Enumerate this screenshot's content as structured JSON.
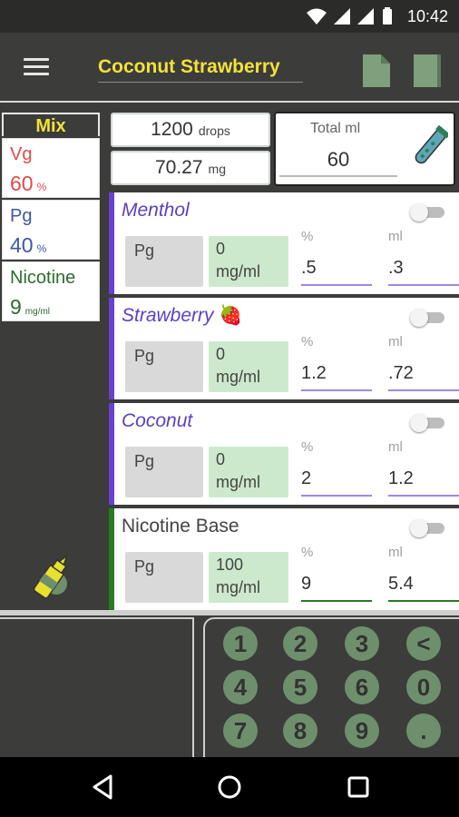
{
  "status_bar": {
    "time": "10:42"
  },
  "app_bar": {
    "title": "Coconut Strawberry"
  },
  "mix": {
    "header": "Mix",
    "vg": {
      "label": "Vg",
      "value": "60",
      "unit": "%"
    },
    "pg": {
      "label": "Pg",
      "value": "40",
      "unit": "%"
    },
    "nicotine": {
      "label": "Nicotine",
      "value": "9",
      "unit": "mg/ml"
    }
  },
  "summary": {
    "drops_value": "1200",
    "drops_unit": "drops",
    "mg_value": "70.27",
    "mg_unit": "mg",
    "total_label": "Total ml",
    "total_value": "60"
  },
  "ingredients": [
    {
      "name": "Menthol",
      "base": "Pg",
      "strength": "0",
      "strength_unit": "mg/ml",
      "percent_label": "%",
      "ml_label": "ml",
      "percent": ".5",
      "ml": ".3"
    },
    {
      "name": "Strawberry",
      "emoji": "🍓",
      "base": "Pg",
      "strength": "0",
      "strength_unit": "mg/ml",
      "percent_label": "%",
      "ml_label": "ml",
      "percent": "1.2",
      "ml": ".72"
    },
    {
      "name": "Coconut",
      "base": "Pg",
      "strength": "0",
      "strength_unit": "mg/ml",
      "percent_label": "%",
      "ml_label": "ml",
      "percent": "2",
      "ml": "1.2"
    },
    {
      "name": "Nicotine Base",
      "base": "Pg",
      "strength": "100",
      "strength_unit": "mg/ml",
      "percent_label": "%",
      "ml_label": "ml",
      "percent": "9",
      "ml": "5.4"
    }
  ],
  "keypad": {
    "keys": [
      "1",
      "2",
      "3",
      "<",
      "4",
      "5",
      "6",
      "0",
      "7",
      "8",
      "9",
      "."
    ]
  },
  "colors": {
    "accent_yellow": "#f3e23a",
    "flavor_purple": "#6a3fd1",
    "nicotine_green": "#2a7a22",
    "vg_red": "#e04a4a",
    "pg_blue": "#3f56a8",
    "key_green": "#6e8f6b"
  }
}
